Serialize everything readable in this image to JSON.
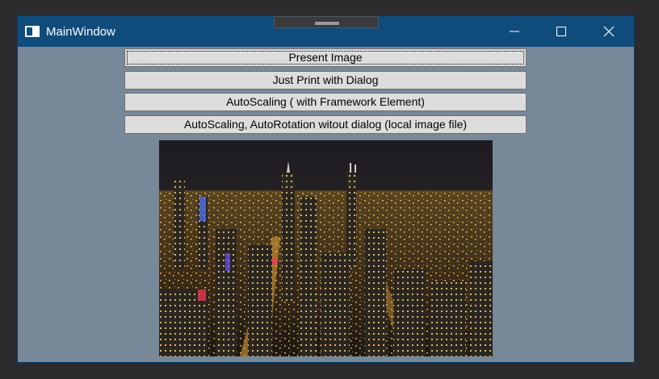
{
  "window": {
    "title": "MainWindow",
    "icon": "window-app-icon",
    "controls": [
      "minimize-icon",
      "maximize-icon",
      "close-icon"
    ],
    "titlebar_color": "#0f4c7c",
    "background_color": "#778899"
  },
  "buttons": [
    {
      "label": "Present Image",
      "focused": true
    },
    {
      "label": "Just Print with Dialog"
    },
    {
      "label": "AutoScaling ( with Framework Element)"
    },
    {
      "label": "AutoScaling, AutoRotation witout dialog (local image file)"
    }
  ],
  "image": {
    "subject": "night city skyline photo"
  }
}
